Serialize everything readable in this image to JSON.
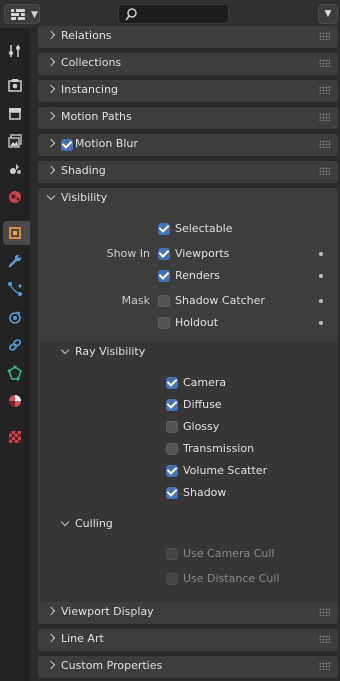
{
  "header": {
    "search": {
      "value": "",
      "placeholder": ""
    }
  },
  "sidebar": {
    "tabs": [
      {
        "name": "tool",
        "icon": "tool-icon"
      },
      {
        "name": "render",
        "icon": "render-icon"
      },
      {
        "name": "output",
        "icon": "output-icon"
      },
      {
        "name": "view-layer",
        "icon": "view-layer-icon"
      },
      {
        "name": "scene",
        "icon": "scene-icon"
      },
      {
        "name": "world",
        "icon": "world-icon"
      },
      {
        "name": "object",
        "icon": "object-icon",
        "active": true
      },
      {
        "name": "modifiers",
        "icon": "wrench-icon"
      },
      {
        "name": "particles",
        "icon": "particles-icon"
      },
      {
        "name": "physics",
        "icon": "physics-icon"
      },
      {
        "name": "constraints",
        "icon": "constraints-icon"
      },
      {
        "name": "data",
        "icon": "mesh-data-icon"
      },
      {
        "name": "material",
        "icon": "material-icon"
      },
      {
        "name": "texture",
        "icon": "texture-icon"
      }
    ]
  },
  "panels": {
    "relations": "Relations",
    "collections": "Collections",
    "instancing": "Instancing",
    "motion_paths": "Motion Paths",
    "motion_blur": {
      "title": "Motion Blur",
      "enabled": true
    },
    "shading": "Shading",
    "visibility": {
      "title": "Visibility",
      "selectable": {
        "label": "Selectable",
        "checked": true
      },
      "show_in_label": "Show In",
      "viewports": {
        "label": "Viewports",
        "checked": true
      },
      "renders": {
        "label": "Renders",
        "checked": true
      },
      "mask_label": "Mask",
      "shadow_catcher": {
        "label": "Shadow Catcher",
        "checked": false
      },
      "holdout": {
        "label": "Holdout",
        "checked": false
      },
      "ray_visibility": {
        "title": "Ray Visibility",
        "items": [
          {
            "label": "Camera",
            "checked": true
          },
          {
            "label": "Diffuse",
            "checked": true
          },
          {
            "label": "Glossy",
            "checked": false
          },
          {
            "label": "Transmission",
            "checked": false
          },
          {
            "label": "Volume Scatter",
            "checked": true
          },
          {
            "label": "Shadow",
            "checked": true
          }
        ]
      },
      "culling": {
        "title": "Culling",
        "use_camera_cull": {
          "label": "Use Camera Cull",
          "checked": false,
          "disabled": true
        },
        "use_distance_cull": {
          "label": "Use Distance Cull",
          "checked": false,
          "disabled": true
        }
      }
    },
    "viewport_display": "Viewport Display",
    "line_art": "Line Art",
    "custom_properties": "Custom Properties"
  },
  "colors": {
    "accent": "#4772b3",
    "panel": "#3d3d3d",
    "background": "#2b2b2b",
    "sidebar": "#232323"
  }
}
